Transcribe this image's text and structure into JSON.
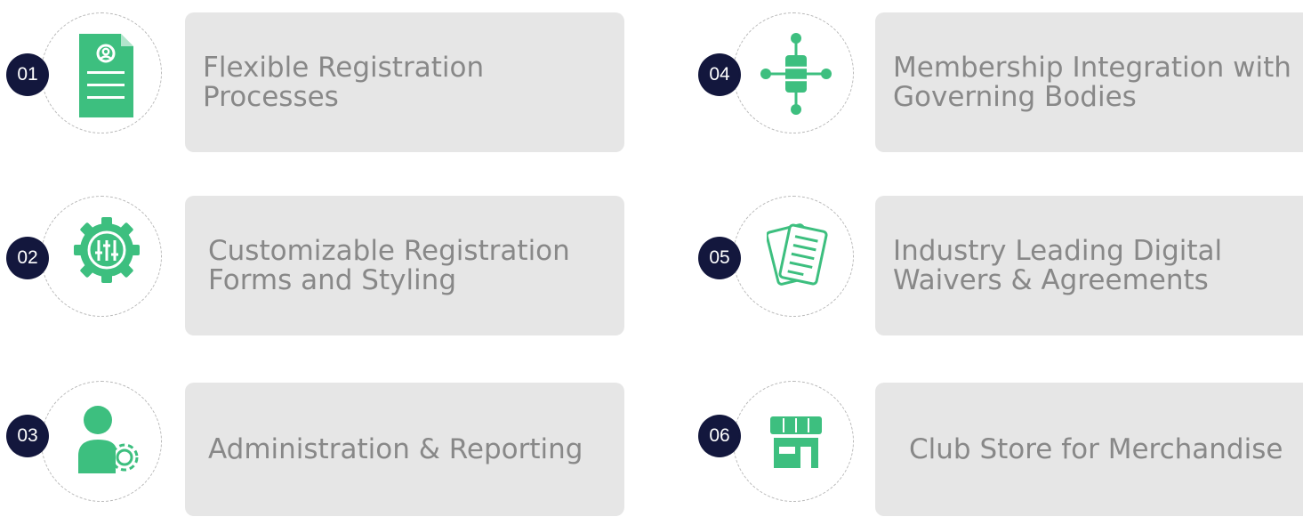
{
  "accent_color": "#3dbf7f",
  "badge_color": "#13173d",
  "features": [
    {
      "number": "01",
      "line1": "Flexible Registration",
      "line2": "Processes",
      "icon": "document-profile-icon"
    },
    {
      "number": "02",
      "line1": "Customizable Registration",
      "line2": "Forms and Styling",
      "icon": "settings-sliders-gear-icon"
    },
    {
      "number": "03",
      "line1": "Administration & Reporting",
      "line2": "",
      "icon": "user-settings-icon"
    },
    {
      "number": "04",
      "line1": "Membership Integration with",
      "line2": "Governing Bodies",
      "icon": "database-network-icon"
    },
    {
      "number": "05",
      "line1": "Industry Leading Digital",
      "line2": "Waivers & Agreements",
      "icon": "documents-stack-icon"
    },
    {
      "number": "06",
      "line1": "Club Store for Merchandise",
      "line2": "",
      "icon": "storefront-icon"
    }
  ]
}
